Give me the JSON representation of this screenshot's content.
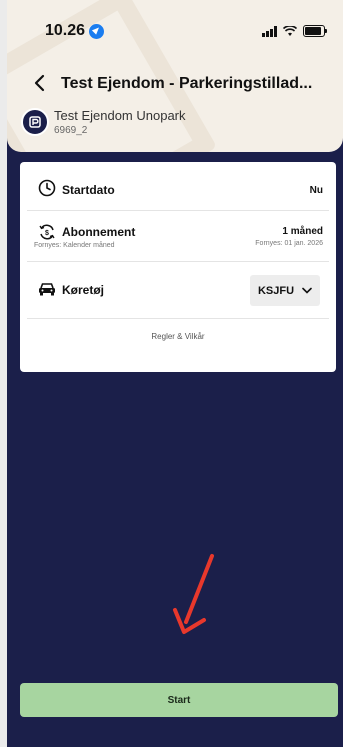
{
  "status_bar": {
    "time": "10.26"
  },
  "header": {
    "title": "Test Ejendom - Parkeringstillad...",
    "property_name": "Test Ejendom Unopark",
    "property_id": "6969_2"
  },
  "form": {
    "start_date": {
      "label": "Startdato",
      "value": "Nu"
    },
    "subscription": {
      "label": "Abonnement",
      "sub": "Fornyes: Kalender måned",
      "value": "1 måned",
      "value_sub": "Fornyes: 01 jan. 2026"
    },
    "vehicle": {
      "label": "Køretøj",
      "selected": "KSJFU"
    },
    "terms_link": "Regler & Vilkår"
  },
  "actions": {
    "start_label": "Start"
  },
  "colors": {
    "background": "#1b1f4a",
    "header_bg": "#f4efe7",
    "start_button": "#a7d5a0",
    "arrow": "#e8382c",
    "location_icon": "#1a7df0"
  },
  "icons": [
    "location-arrow-icon",
    "signal-icon",
    "wifi-icon",
    "battery-icon",
    "back-chevron-icon",
    "property-logo-icon",
    "clock-icon",
    "subscription-renew-icon",
    "car-icon",
    "chevron-down-icon",
    "red-arrow-annotation"
  ]
}
